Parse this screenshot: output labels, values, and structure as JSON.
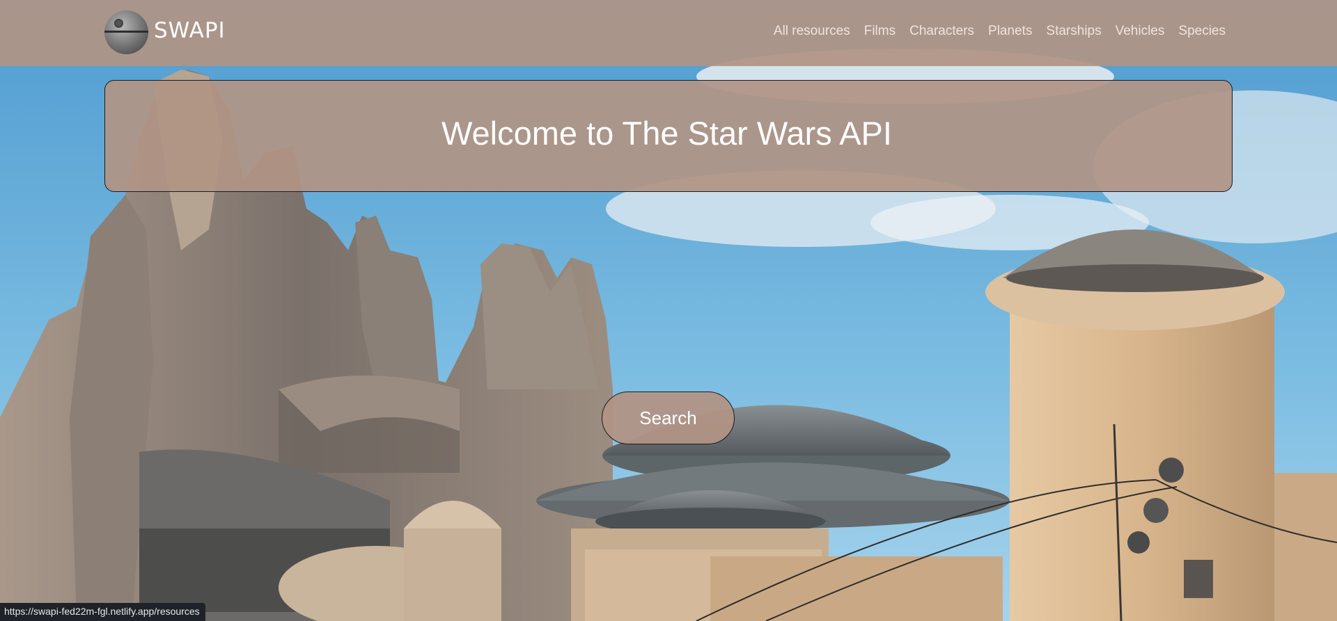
{
  "brand": {
    "name": "SWAPI",
    "logo_icon": "death-star-icon"
  },
  "nav": {
    "links": [
      "All resources",
      "Films",
      "Characters",
      "Planets",
      "Starships",
      "Vehicles",
      "Species"
    ]
  },
  "hero": {
    "title": "Welcome to The Star Wars API"
  },
  "search": {
    "label": "Search"
  },
  "status_bar": {
    "url": "https://swapi-fed22m-fgl.netlify.app/resources"
  },
  "colors": {
    "panel": "#b09485",
    "sky": "#6fb2dc",
    "status_bar": "#1f2229"
  }
}
